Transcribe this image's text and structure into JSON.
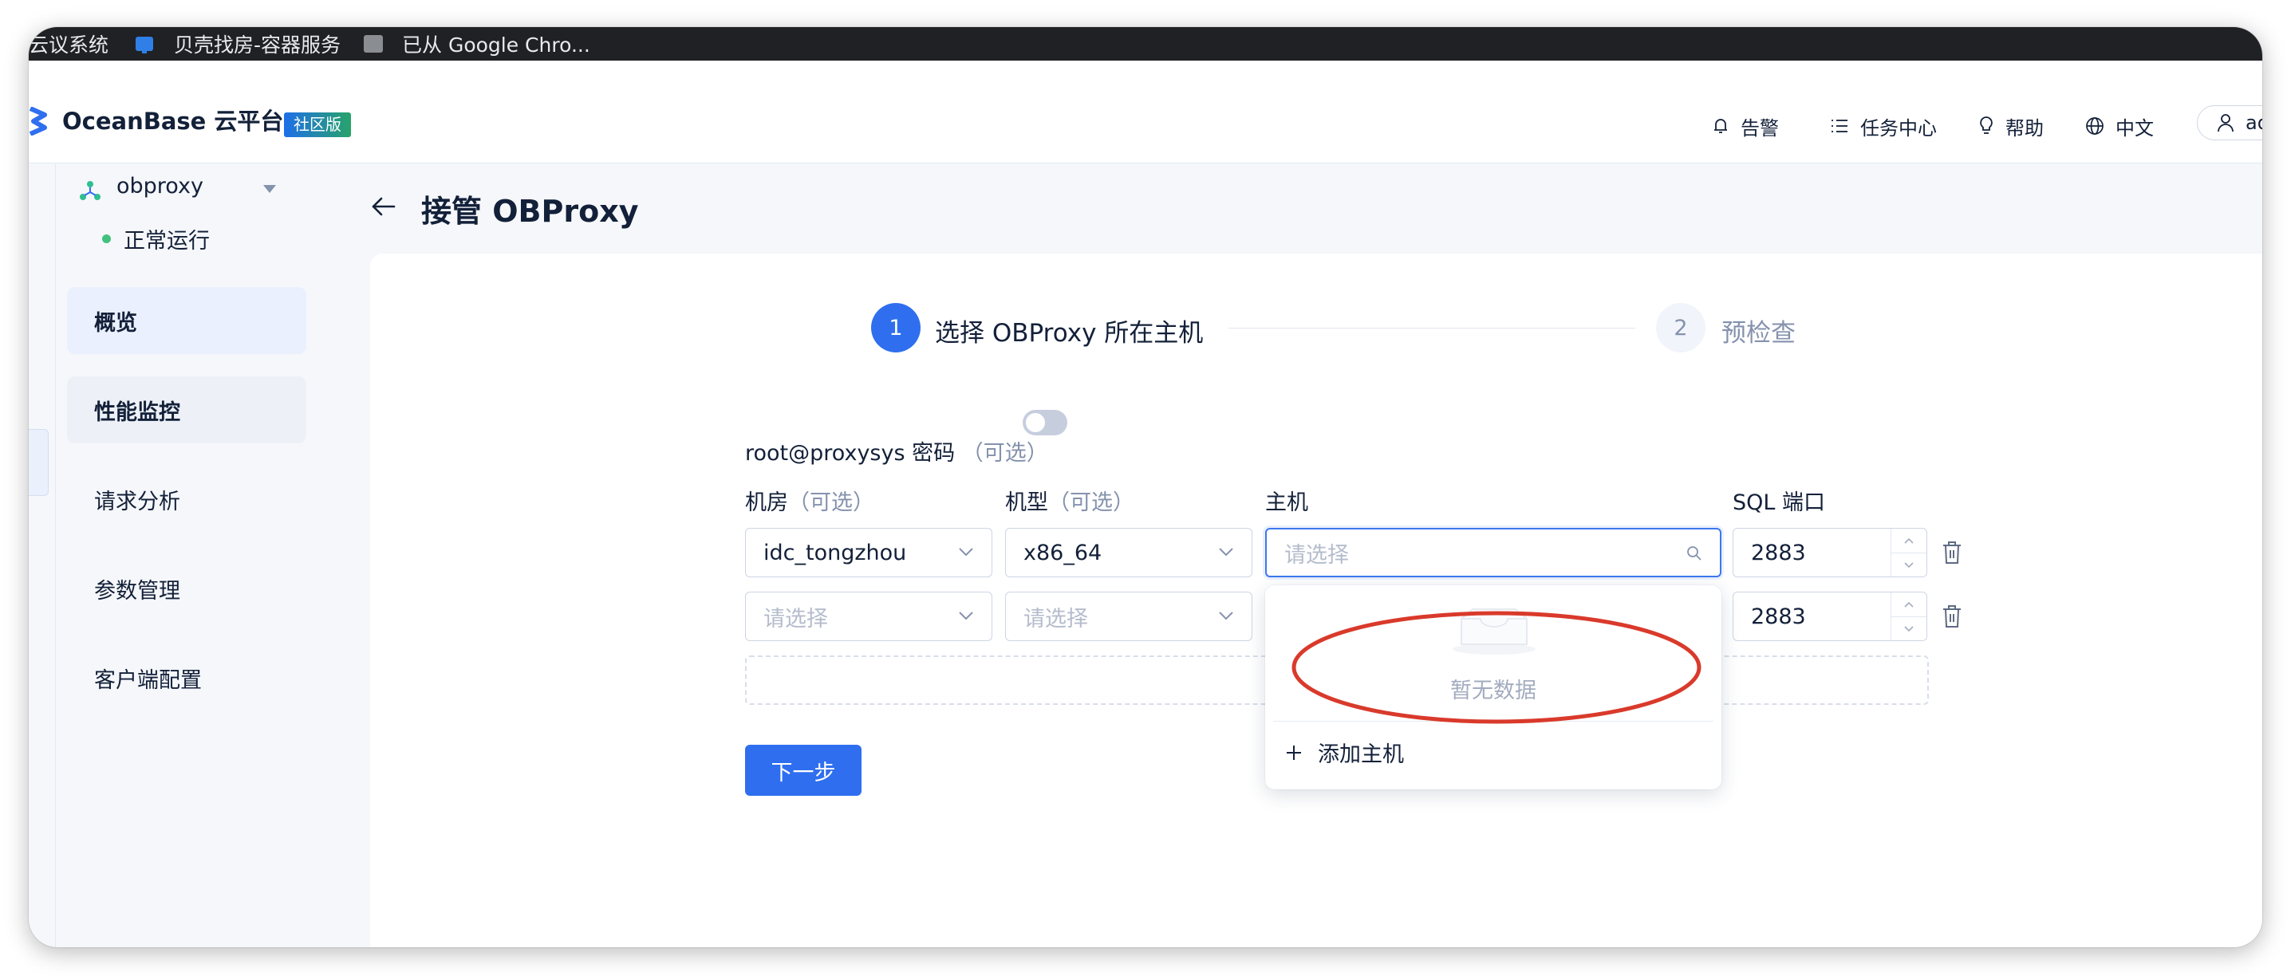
{
  "bookmarks": [
    {
      "label": "云议系统"
    },
    {
      "label": "贝壳找房-容器服务",
      "icon": "bookmark-blue-icon"
    },
    {
      "label": "已从 Google Chro...",
      "icon": "folder-icon"
    }
  ],
  "header": {
    "brand": "OceanBase 云平台",
    "badge": "社区版",
    "alerts": "告警",
    "tasks": "任务中心",
    "help": "帮助",
    "language": "中文",
    "user": "ad"
  },
  "sidebar": {
    "cluster_name": "obproxy",
    "cluster_status": "正常运行",
    "items": [
      {
        "label": "概览"
      },
      {
        "label": "性能监控"
      },
      {
        "label": "请求分析"
      },
      {
        "label": "参数管理"
      },
      {
        "label": "客户端配置"
      }
    ]
  },
  "page": {
    "title": "接管 OBProxy"
  },
  "steps": [
    {
      "num": "1",
      "label": "选择 OBProxy 所在主机"
    },
    {
      "num": "2",
      "label": "预检查"
    }
  ],
  "form": {
    "password_label": "root@proxysys 密码",
    "optional": "（可选）",
    "col_room": "机房",
    "col_model": "机型",
    "col_host": "主机",
    "col_port": "SQL 端口",
    "rows": [
      {
        "room": "idc_tongzhou",
        "model": "x86_64",
        "host_placeholder": "请选择",
        "port": "2883"
      },
      {
        "room_placeholder": "请选择",
        "model_placeholder": "请选择",
        "port": "2883"
      }
    ],
    "next": "下一步"
  },
  "dropdown": {
    "empty": "暂无数据",
    "add_host": "添加主机"
  },
  "colors": {
    "primary": "#2f6fef",
    "annotation": "#d93a2b",
    "status_ok": "#42c17e"
  }
}
